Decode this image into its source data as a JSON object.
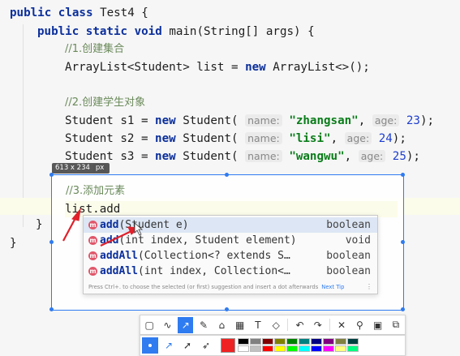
{
  "code": {
    "line1": {
      "kw1": "public",
      "kw2": "class",
      "name": "Test4 {"
    },
    "line2": {
      "kw1": "public",
      "kw2": "static",
      "kw3": "void",
      "rest": "main(String[] args) {"
    },
    "comment1": "//1.创建集合",
    "line4": {
      "pre": "ArrayList<Student> list = ",
      "kw": "new",
      "post": " ArrayList<>();"
    },
    "comment2": "//2.创建学生对象",
    "students": [
      {
        "pre": "Student s1 = ",
        "kw": "new",
        "ctor": " Student(",
        "hint_name": "name:",
        "str": "\"zhangsan\"",
        "comma": ",",
        "hint_age": "age:",
        "num": "23",
        "end": ");"
      },
      {
        "pre": "Student s2 = ",
        "kw": "new",
        "ctor": " Student(",
        "hint_name": "name:",
        "str": "\"lisi\"",
        "comma": ",",
        "hint_age": "age:",
        "num": "24",
        "end": ");"
      },
      {
        "pre": "Student s3 = ",
        "kw": "new",
        "ctor": " Student(",
        "hint_name": "name:",
        "str": "\"wangwu\"",
        "comma": ",",
        "hint_age": "age:",
        "num": "25",
        "end": ");"
      }
    ],
    "comment3": "//3.添加元素",
    "current_line": "list.add",
    "close_inner": "}",
    "close_outer": "}"
  },
  "selection": {
    "dimensions": "613 x 234",
    "unit": "px"
  },
  "popup": {
    "items": [
      {
        "icon": "m",
        "name_bold": "add",
        "params": "(Student e)",
        "type": "boolean",
        "selected": true
      },
      {
        "icon": "m",
        "name_bold": "add",
        "params": "(int index, Student element)",
        "type": "void",
        "selected": false
      },
      {
        "icon": "m",
        "name_bold": "addAll",
        "params": "(Collection<? extends S…",
        "type": "boolean",
        "selected": false
      },
      {
        "icon": "m",
        "name_bold": "addAll",
        "params": "(int index, Collection<…",
        "type": "boolean",
        "selected": false
      }
    ],
    "footer": "Press Ctrl+. to choose the selected (or first) suggestion and insert a dot afterwards",
    "footer_link": "Next Tip",
    "more": "⋮"
  },
  "toolbar": {
    "row1_icons": [
      "rect-select-icon",
      "curve-icon",
      "arrow-icon",
      "pencil-icon",
      "highlighter-icon",
      "mosaic-icon",
      "text-icon",
      "eraser-icon",
      "undo-icon",
      "redo-icon",
      "close-icon",
      "pin-icon",
      "save-icon",
      "copy-icon"
    ],
    "active_tool": "arrow-icon",
    "current_color": "#ee2222",
    "palette": [
      "#000000",
      "#808080",
      "#800000",
      "#808000",
      "#008000",
      "#008080",
      "#000080",
      "#800080",
      "#808040",
      "#004040",
      "#ffffff",
      "#c0c0c0",
      "#ff0000",
      "#ffff00",
      "#00ff00",
      "#00ffff",
      "#0000ff",
      "#ff00ff",
      "#ffff80",
      "#00ff80"
    ]
  },
  "colors": {
    "keyword": "#0b2f9c",
    "string": "#0a7d1a",
    "comment": "#6a8a5a",
    "selection": "#2f7bf0",
    "annotation": "#e0202a"
  }
}
